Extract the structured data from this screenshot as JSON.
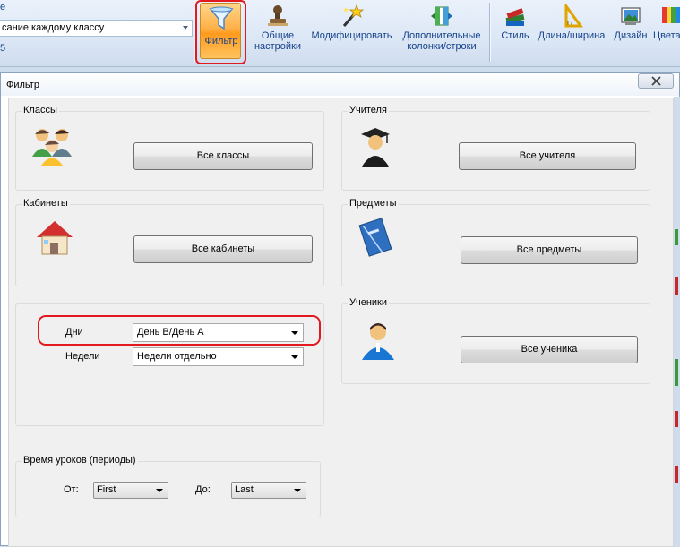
{
  "ribbon": {
    "left_top": "е",
    "combo_value": "сание каждому классу",
    "left_number": "5",
    "buttons": {
      "filter": "Фильтр",
      "general_line1": "Общие",
      "general_line2": "настройки",
      "modify": "Модифицировать",
      "extra_line1": "Дополнительные",
      "extra_line2": "колонки/строки",
      "style": "Стиль",
      "length": "Длина/ширина",
      "design": "Дизайн",
      "colors": "Цвета"
    },
    "icons": {
      "filter": "funnel-icon",
      "general": "stamp-icon",
      "modify": "magic-wand-icon",
      "extra": "table-columns-icon",
      "style": "books-icon",
      "length": "ruler-triangle-icon",
      "design": "picture-icon",
      "colors": "palette-icon"
    }
  },
  "dialog": {
    "title": "Фильтр",
    "classes": {
      "caption": "Классы",
      "button": "Все классы",
      "icon": "group-users-icon"
    },
    "teachers": {
      "caption": "Учителя",
      "button": "Все учителя",
      "icon": "teacher-graduate-icon"
    },
    "rooms": {
      "caption": "Кабинеты",
      "button": "Все кабинеты",
      "icon": "house-icon"
    },
    "subjects": {
      "caption": "Предметы",
      "button": "Все предметы",
      "icon": "notebook-icon"
    },
    "students": {
      "caption": "Ученики",
      "button": "Все ученика",
      "icon": "student-icon"
    },
    "days_weeks": {
      "days_label": "Дни",
      "days_value": "День В/День А",
      "weeks_label": "Недели",
      "weeks_value": "Недели отдельно"
    },
    "periods": {
      "caption": "Время уроков (периоды)",
      "from_label": "От:",
      "from_value": "First",
      "to_label": "До:",
      "to_value": "Last"
    }
  },
  "colors": {
    "highlight_frame": "#e2191f",
    "ribbon_text": "#15428b",
    "dialog_bg": "#f0f0f0"
  }
}
